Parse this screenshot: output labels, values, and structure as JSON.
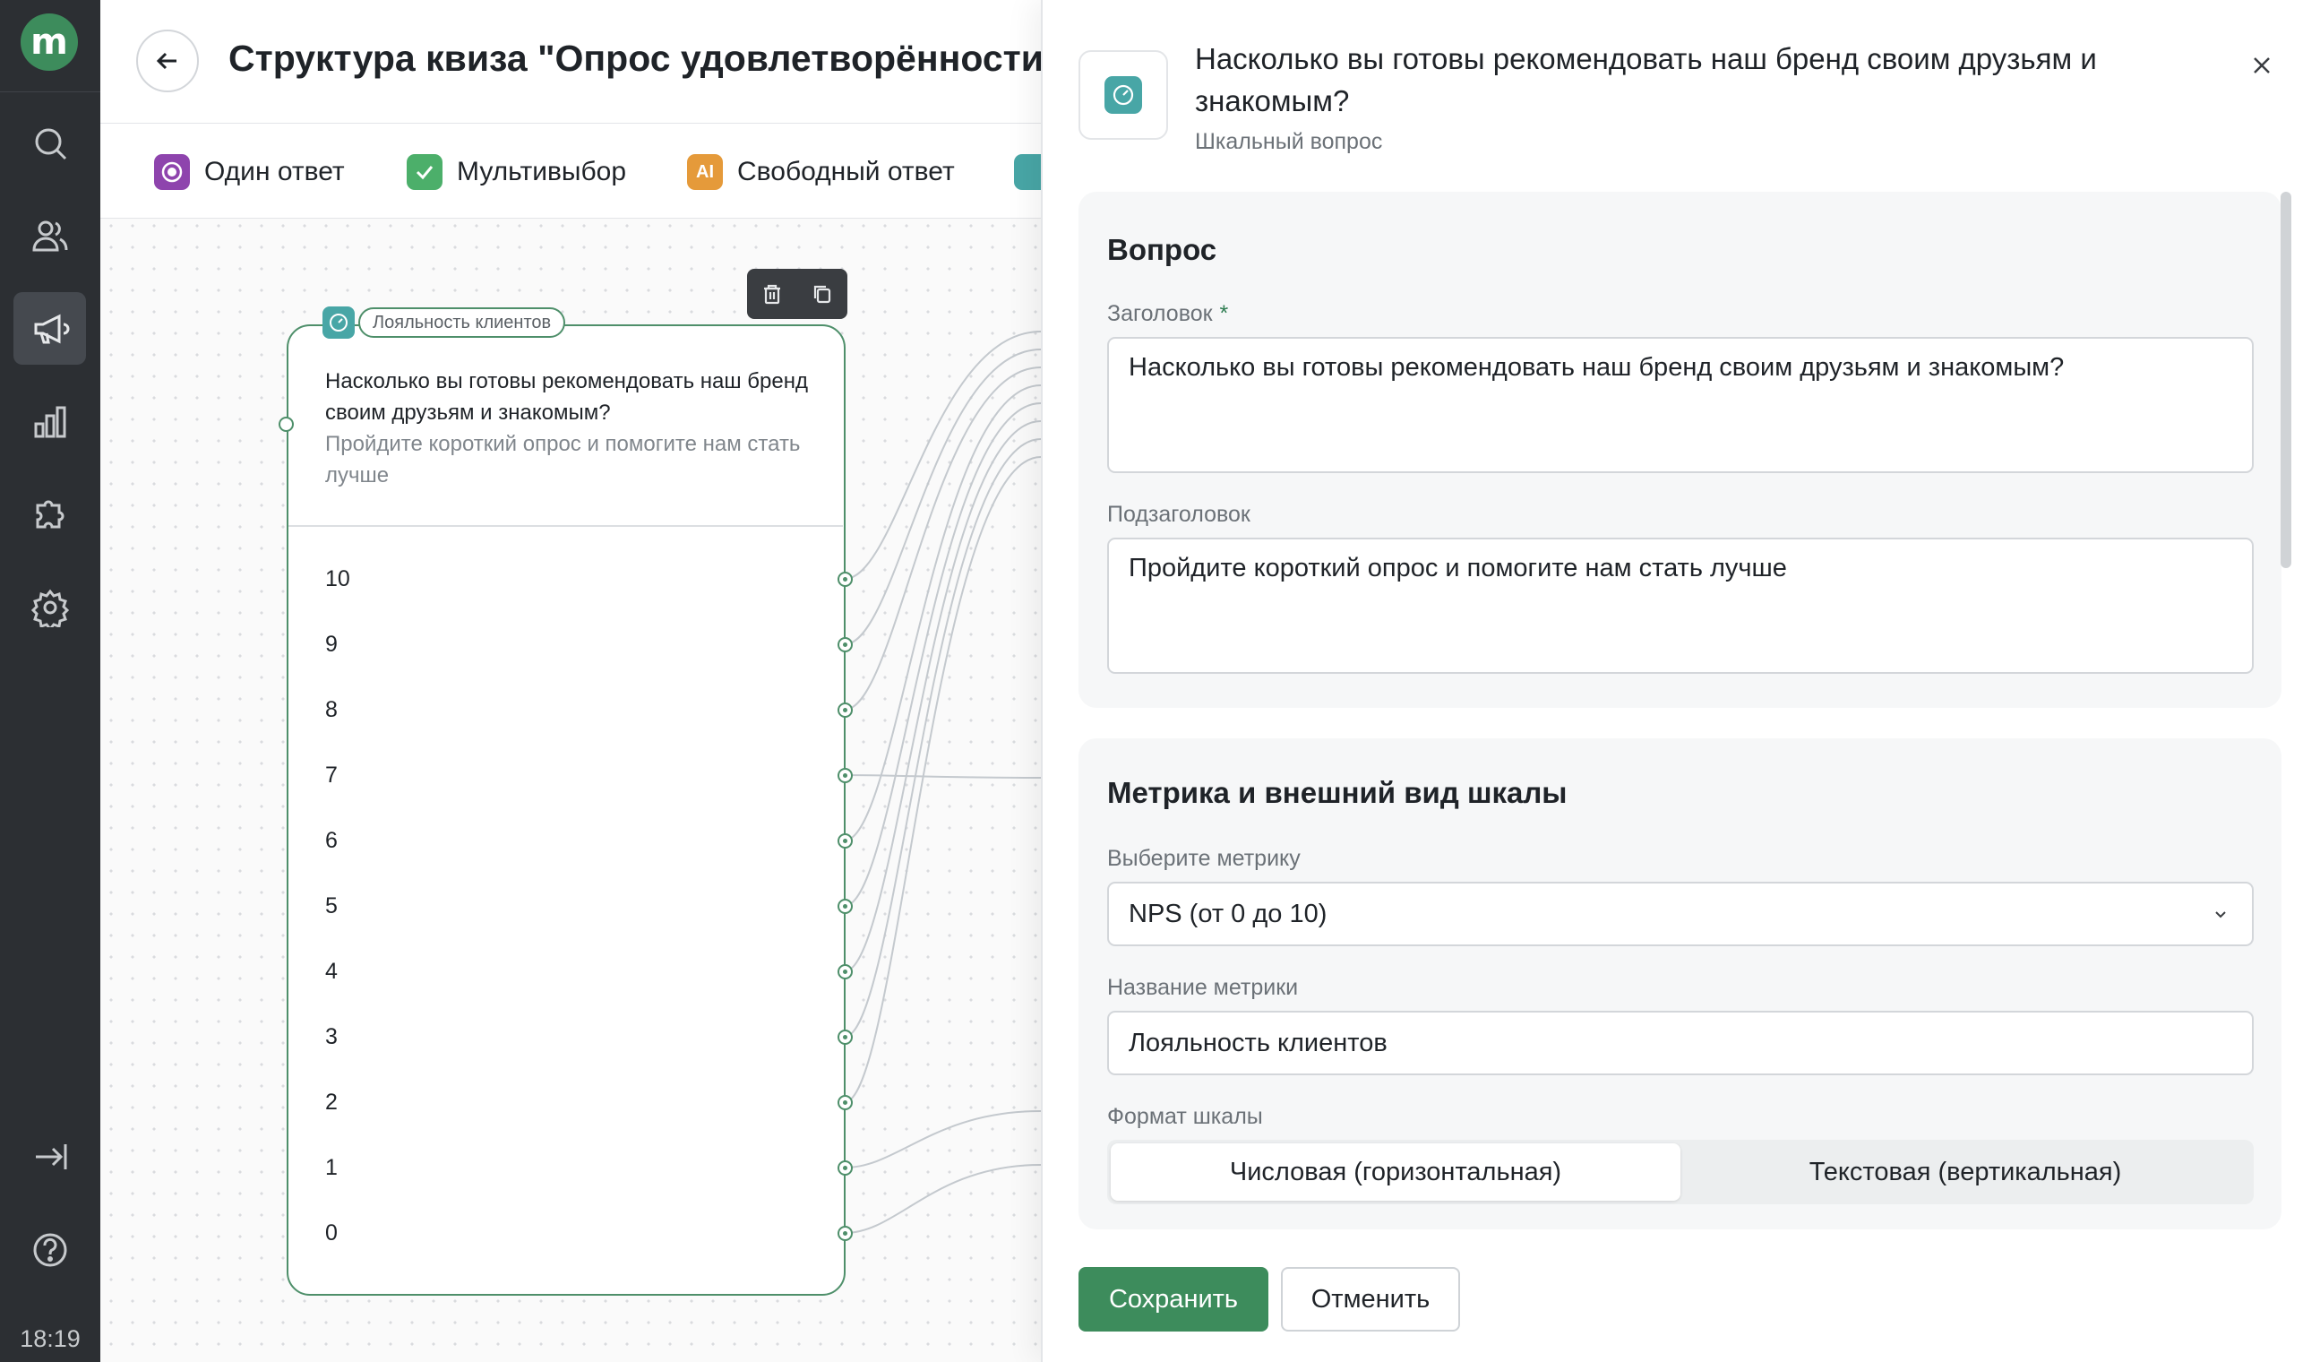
{
  "app": {
    "logo_letter": "m",
    "time": "18:19",
    "accent": "#3d8c5c"
  },
  "sidebar": {
    "items": [
      {
        "name": "search-icon"
      },
      {
        "name": "users-icon"
      },
      {
        "name": "megaphone-icon",
        "active": true
      },
      {
        "name": "chart-icon"
      },
      {
        "name": "puzzle-icon"
      },
      {
        "name": "settings-icon"
      },
      {
        "name": "logout-icon"
      },
      {
        "name": "help-icon"
      }
    ]
  },
  "header": {
    "title": "Структура квиза \"Опрос удовлетворённости"
  },
  "toolbar": {
    "items": [
      {
        "label": "Один ответ",
        "icon": "radio-icon",
        "color": "#8e44ad"
      },
      {
        "label": "Мультивыбор",
        "icon": "checkbox-icon",
        "color": "#4caf6a"
      },
      {
        "label": "Свободный ответ",
        "icon": "text-ai-icon",
        "color": "#e59a3a"
      }
    ]
  },
  "node": {
    "tag": "Лояльность клиентов",
    "title": "Насколько вы готовы рекомендовать наш бренд своим друзьям и знакомым?",
    "subtitle": "Пройдите короткий опрос и помогите нам стать лучше",
    "options": [
      "10",
      "9",
      "8",
      "7",
      "6",
      "5",
      "4",
      "3",
      "2",
      "1",
      "0"
    ]
  },
  "panel": {
    "title": "Насколько вы готовы рекомендовать наш бренд своим друзьям и знакомым?",
    "type": "Шкальный вопрос",
    "question": {
      "section_title": "Вопрос",
      "heading_label": "Заголовок",
      "required_mark": "*",
      "heading_value": "Насколько вы готовы рекомендовать наш бренд своим друзьям и знакомым?",
      "subheading_label": "Подзаголовок",
      "subheading_value": "Пройдите короткий опрос и помогите нам стать лучше"
    },
    "metric": {
      "section_title": "Метрика и внешний вид шкалы",
      "select_label": "Выберите метрику",
      "select_value": "NPS (от 0 до 10)",
      "name_label": "Название метрики",
      "name_value": "Лояльность клиентов",
      "format_label": "Формат шкалы",
      "format_options": [
        "Числовая (горизонтальная)",
        "Текстовая (вертикальная)"
      ],
      "format_selected": "Числовая (горизонтальная)"
    },
    "save_label": "Сохранить",
    "cancel_label": "Отменить"
  }
}
